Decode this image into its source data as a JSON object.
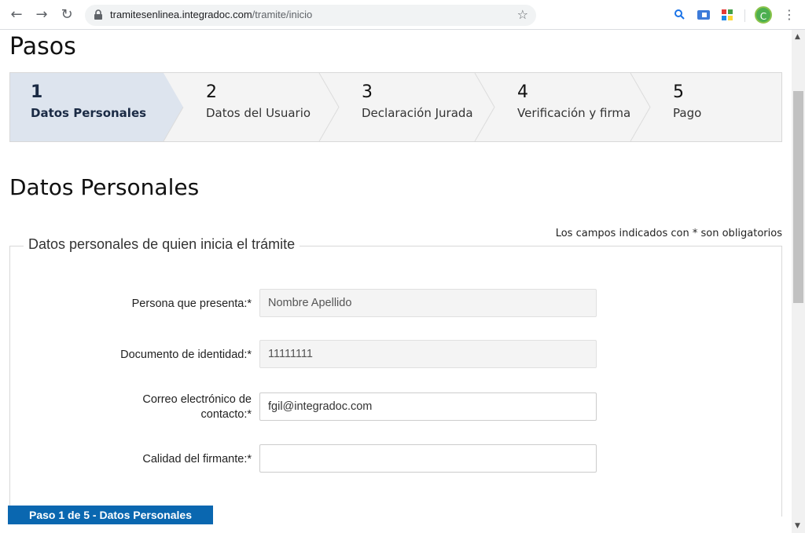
{
  "browser": {
    "url_host": "tramitesenlinea.integradoc.com",
    "url_path": "/tramite/inicio",
    "profile_initial": "C"
  },
  "page": {
    "heading": "Pasos",
    "section_heading": "Datos Personales",
    "required_note": "Los campos indicados con * son obligatorios",
    "fieldset_legend": "Datos personales de quien inicia el trámite",
    "step_badge": "Paso 1 de 5 - Datos Personales"
  },
  "steps": [
    {
      "num": "1",
      "label": "Datos Personales",
      "active": true
    },
    {
      "num": "2",
      "label": "Datos del Usuario",
      "active": false
    },
    {
      "num": "3",
      "label": "Declaración Jurada",
      "active": false
    },
    {
      "num": "4",
      "label": "Verificación y firma",
      "active": false
    },
    {
      "num": "5",
      "label": "Pago",
      "active": false
    }
  ],
  "form": {
    "presenter": {
      "label": "Persona que presenta:*",
      "value": "Nombre Apellido"
    },
    "id_document": {
      "label": "Documento de identidad:*",
      "value": "11111111"
    },
    "email": {
      "label": "Correo electrónico de contacto:*",
      "value": "fgil@integradoc.com"
    },
    "signer_quality": {
      "label": "Calidad del firmante:*",
      "value": ""
    }
  },
  "colors": {
    "active_step_bg": "#dde4ee",
    "inactive_step_bg": "#f4f4f4",
    "badge_bg": "#0a67b0"
  }
}
